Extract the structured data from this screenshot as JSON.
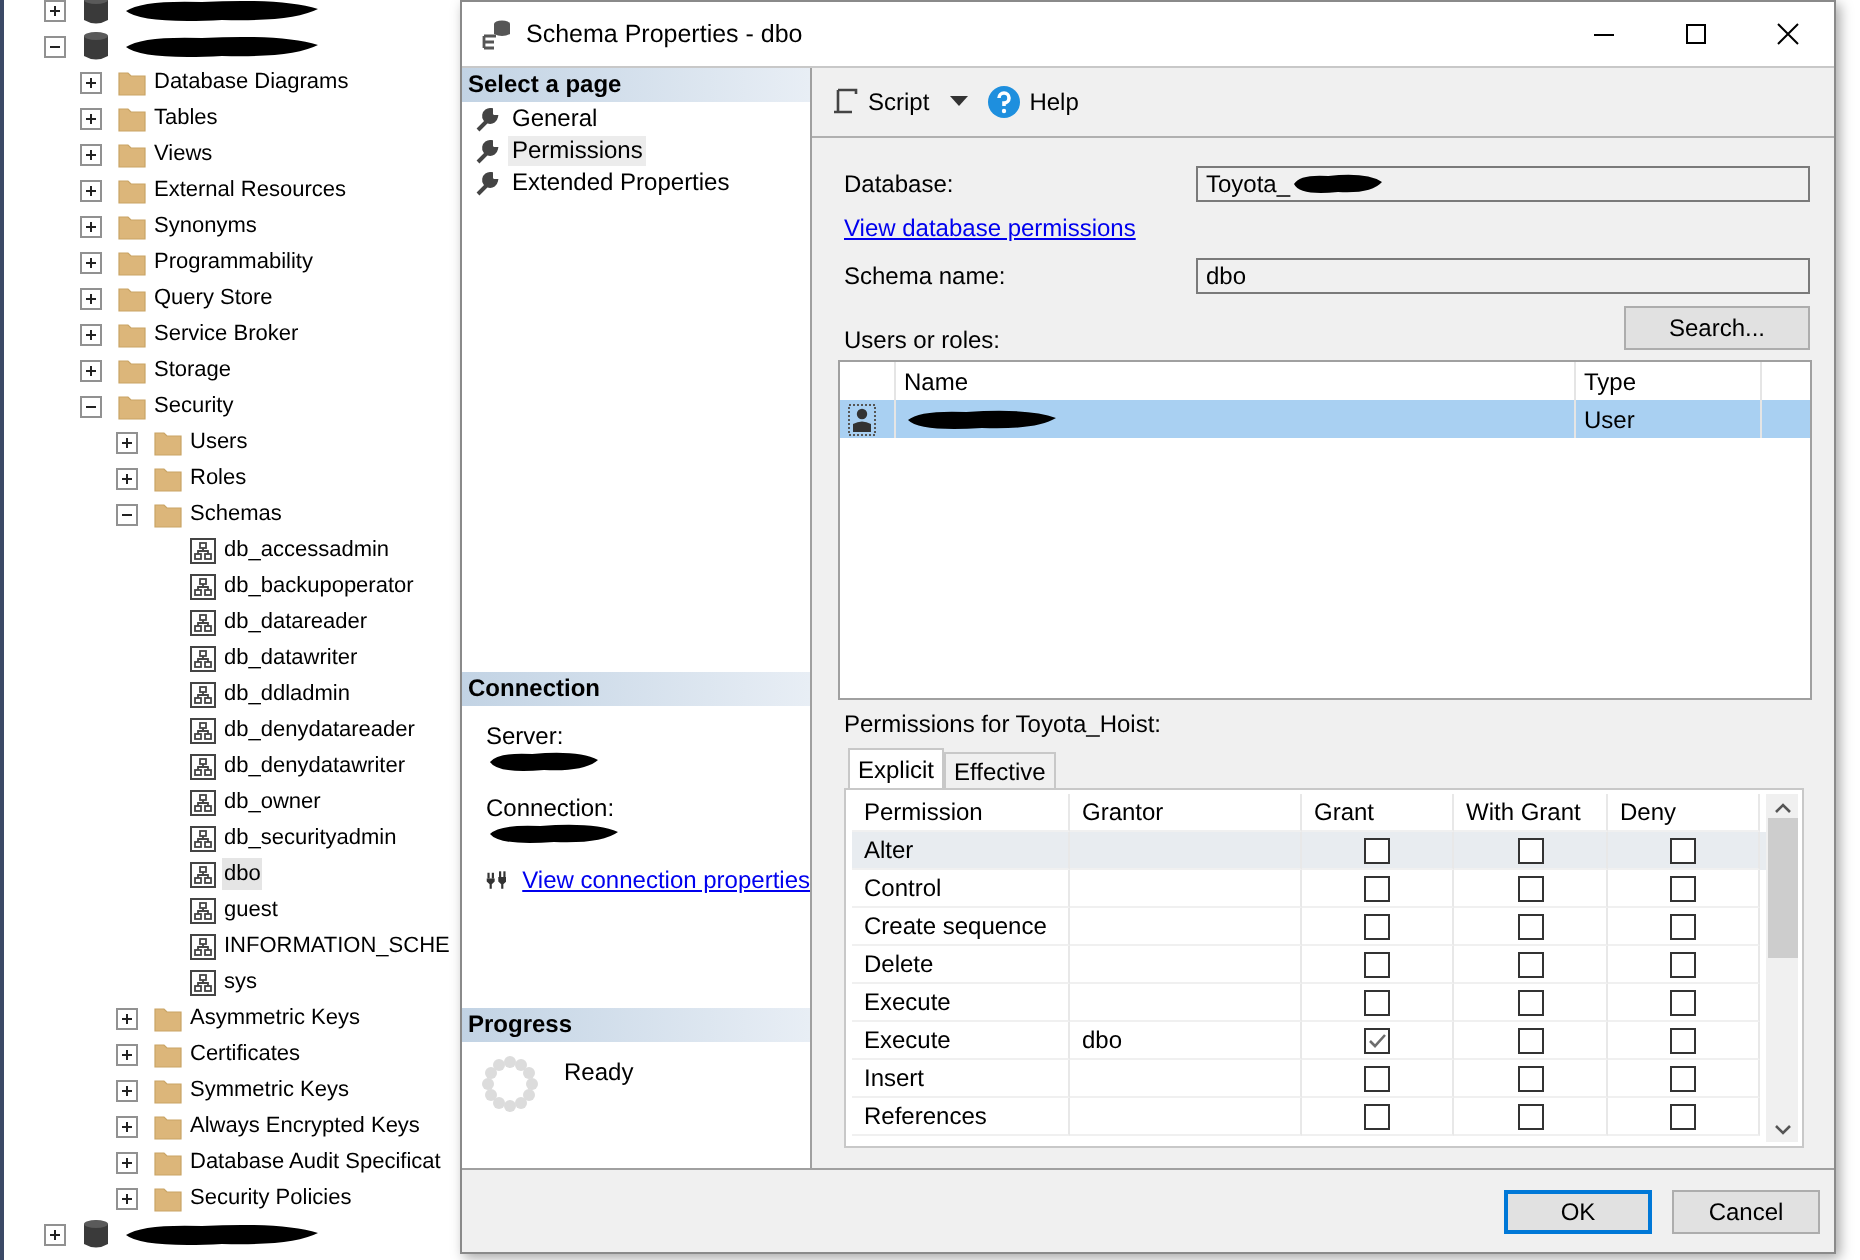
{
  "explorer": {
    "tree": [
      {
        "kind": "database",
        "expanded": false
      },
      {
        "kind": "database",
        "expanded": true,
        "children": [
          {
            "kind": "folder",
            "label": "Database Diagrams",
            "expanded": false
          },
          {
            "kind": "folder",
            "label": "Tables",
            "expanded": false
          },
          {
            "kind": "folder",
            "label": "Views",
            "expanded": false
          },
          {
            "kind": "folder",
            "label": "External Resources",
            "expanded": false
          },
          {
            "kind": "folder",
            "label": "Synonyms",
            "expanded": false
          },
          {
            "kind": "folder",
            "label": "Programmability",
            "expanded": false
          },
          {
            "kind": "folder",
            "label": "Query Store",
            "expanded": false
          },
          {
            "kind": "folder",
            "label": "Service Broker",
            "expanded": false
          },
          {
            "kind": "folder",
            "label": "Storage",
            "expanded": false
          },
          {
            "kind": "folder",
            "label": "Security",
            "expanded": true,
            "children": [
              {
                "kind": "folder",
                "label": "Users",
                "expanded": false
              },
              {
                "kind": "folder",
                "label": "Roles",
                "expanded": false
              },
              {
                "kind": "folder",
                "label": "Schemas",
                "expanded": true,
                "children": [
                  {
                    "kind": "schema",
                    "label": "db_accessadmin",
                    "selected": false
                  },
                  {
                    "kind": "schema",
                    "label": "db_backupoperator",
                    "selected": false
                  },
                  {
                    "kind": "schema",
                    "label": "db_datareader",
                    "selected": false
                  },
                  {
                    "kind": "schema",
                    "label": "db_datawriter",
                    "selected": false
                  },
                  {
                    "kind": "schema",
                    "label": "db_ddladmin",
                    "selected": false
                  },
                  {
                    "kind": "schema",
                    "label": "db_denydatareader",
                    "selected": false
                  },
                  {
                    "kind": "schema",
                    "label": "db_denydatawriter",
                    "selected": false
                  },
                  {
                    "kind": "schema",
                    "label": "db_owner",
                    "selected": false
                  },
                  {
                    "kind": "schema",
                    "label": "db_securityadmin",
                    "selected": false
                  },
                  {
                    "kind": "schema",
                    "label": "dbo",
                    "selected": true
                  },
                  {
                    "kind": "schema",
                    "label": "guest",
                    "selected": false
                  },
                  {
                    "kind": "schema",
                    "label": "INFORMATION_SCHE",
                    "selected": false
                  },
                  {
                    "kind": "schema",
                    "label": "sys",
                    "selected": false
                  }
                ]
              },
              {
                "kind": "folder",
                "label": "Asymmetric Keys",
                "expanded": false
              },
              {
                "kind": "folder",
                "label": "Certificates",
                "expanded": false
              },
              {
                "kind": "folder",
                "label": "Symmetric Keys",
                "expanded": false
              },
              {
                "kind": "folder",
                "label": "Always Encrypted Keys",
                "expanded": false
              },
              {
                "kind": "folder",
                "label": "Database Audit Specificat",
                "expanded": false
              },
              {
                "kind": "folder",
                "label": "Security Policies",
                "expanded": false
              }
            ]
          }
        ]
      },
      {
        "kind": "database",
        "expanded": false
      }
    ]
  },
  "dialog": {
    "title": "Schema Properties - dbo",
    "pages_header": "Select a page",
    "pages": [
      {
        "label": "General",
        "selected": false
      },
      {
        "label": "Permissions",
        "selected": true
      },
      {
        "label": "Extended Properties",
        "selected": false
      }
    ],
    "connection": {
      "header": "Connection",
      "server_label": "Server:",
      "connection_label": "Connection:",
      "link": "View connection properties"
    },
    "progress": {
      "header": "Progress",
      "status": "Ready"
    },
    "toolbar": {
      "script": "Script",
      "help": "Help"
    },
    "database": {
      "label": "Database:",
      "value": "Toyota_"
    },
    "database_permissions_link": "View database permissions",
    "schema_name": {
      "label": "Schema name:",
      "value": "dbo"
    },
    "users": {
      "label": "Users or roles:",
      "search_button": "Search...",
      "columns": [
        "Name",
        "Type"
      ],
      "rows": [
        {
          "type": "User",
          "selected": true
        }
      ]
    },
    "permissions": {
      "label": "Permissions for Toyota_Hoist:",
      "tabs": [
        {
          "label": "Explicit",
          "selected": true
        },
        {
          "label": "Effective",
          "selected": false
        }
      ],
      "columns": [
        "Permission",
        "Grantor",
        "Grant",
        "With Grant",
        "Deny"
      ],
      "rows": [
        {
          "permission": "Alter",
          "grant": false,
          "with_grant": false,
          "deny": false,
          "selected": true
        },
        {
          "permission": "Control",
          "grant": false,
          "with_grant": false,
          "deny": false,
          "selected": false
        },
        {
          "permission": "Create sequence",
          "grant": false,
          "with_grant": false,
          "deny": false,
          "selected": false
        },
        {
          "permission": "Delete",
          "grant": false,
          "with_grant": false,
          "deny": false,
          "selected": false
        },
        {
          "permission": "Execute",
          "grant": false,
          "with_grant": false,
          "deny": false,
          "selected": false
        },
        {
          "permission": "Execute",
          "grantor": "dbo",
          "grant": true,
          "with_grant": false,
          "deny": false,
          "selected": false
        },
        {
          "permission": "Insert",
          "grant": false,
          "with_grant": false,
          "deny": false,
          "selected": false
        },
        {
          "permission": "References",
          "grant": false,
          "with_grant": false,
          "deny": false,
          "selected": false
        }
      ]
    },
    "buttons": [
      {
        "label": "OK",
        "default": true
      },
      {
        "label": "Cancel",
        "default": false
      }
    ]
  }
}
